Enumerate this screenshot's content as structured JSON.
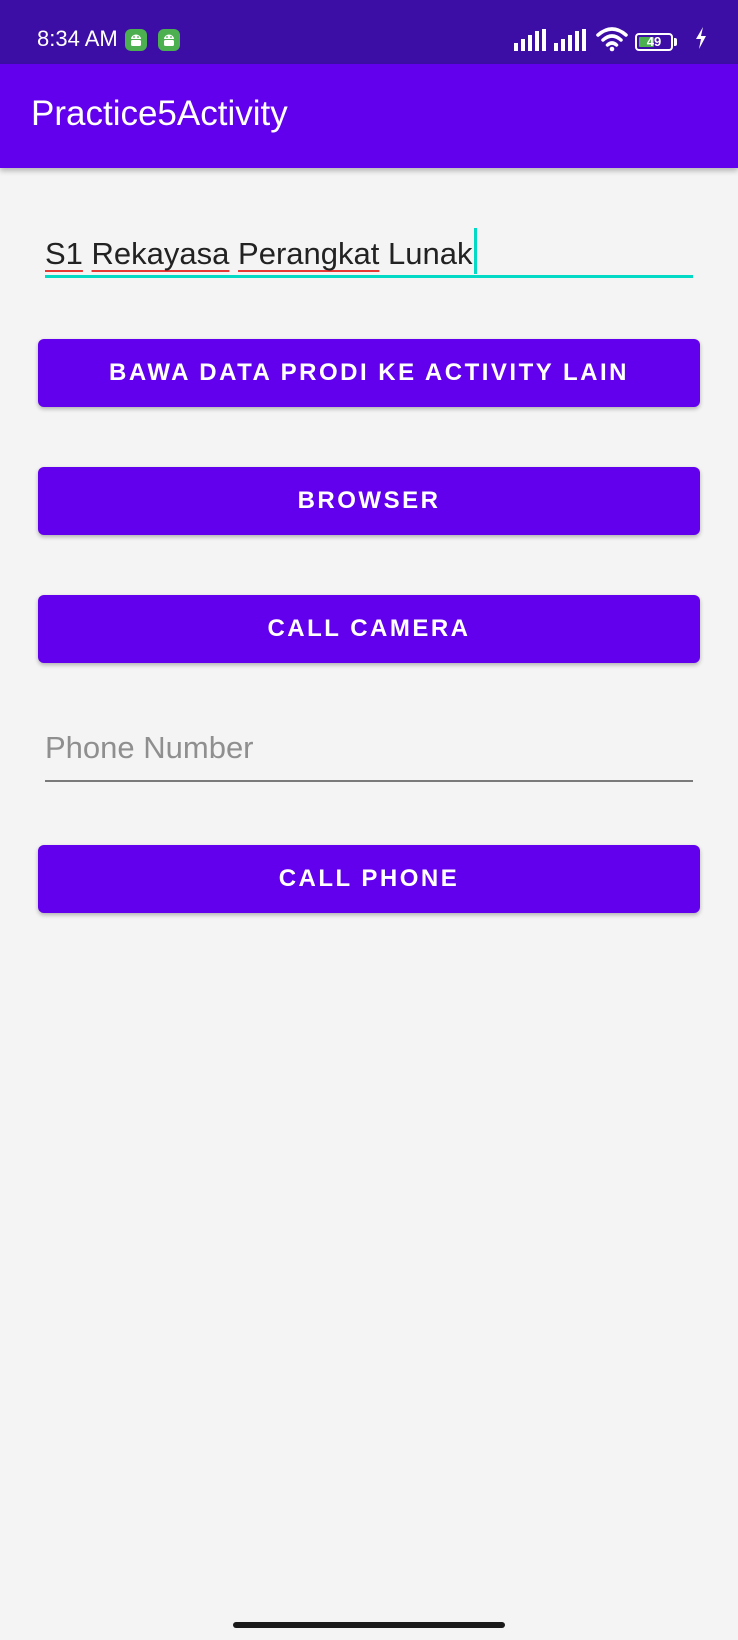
{
  "status_bar": {
    "time": "8:34 AM",
    "notification_icons": [
      "android-icon",
      "android-icon"
    ],
    "battery_level": "49",
    "battery_percent": 49,
    "charging": true,
    "icons": [
      "signal-icon",
      "signal-icon",
      "wifi-icon",
      "battery-icon",
      "charging-icon"
    ]
  },
  "app_bar": {
    "title": "Practice5Activity"
  },
  "prodi_input": {
    "value_words": [
      "S1",
      "Rekayasa",
      "Perangkat",
      "Lunak"
    ]
  },
  "buttons": {
    "send_prodi": "BAWA DATA PRODI KE ACTIVITY LAIN",
    "browser": "BROWSER",
    "call_camera": "CALL CAMERA",
    "call_phone": "CALL PHONE"
  },
  "phone_input": {
    "value": "",
    "placeholder": "Phone Number"
  },
  "colors": {
    "primary": "#6200ee",
    "primary_dark": "#3d0ea6",
    "accent": "#03dac5",
    "background": "#f4f4f4"
  }
}
